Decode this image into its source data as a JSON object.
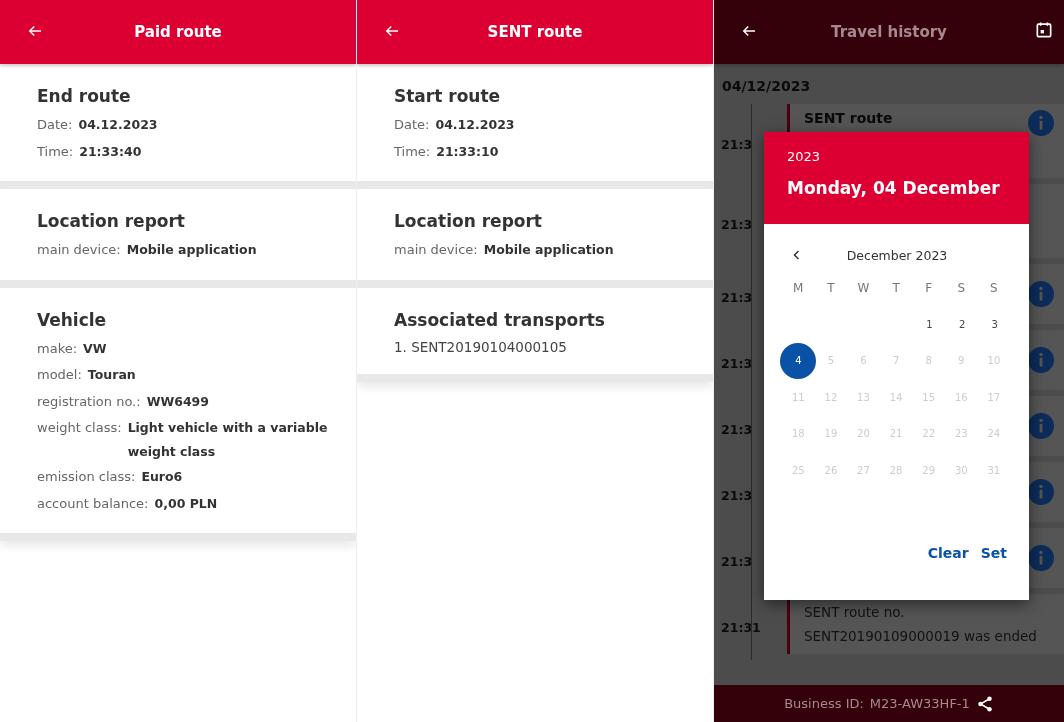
{
  "screens": [
    {
      "kind": "detail",
      "title": "Paid route",
      "sections": [
        {
          "title": "End route",
          "fields": [
            {
              "label": "Date:",
              "value": "04.12.2023"
            },
            {
              "label": "Time:",
              "value": "21:33:40"
            }
          ]
        },
        {
          "title": "Location report",
          "fields": [
            {
              "label": "main device:",
              "value": "Mobile application"
            }
          ]
        },
        {
          "title": "Vehicle",
          "fields": [
            {
              "label": "make:",
              "value": "VW"
            },
            {
              "label": "model:",
              "value": "Touran"
            },
            {
              "label": "registration no.:",
              "value": "WW6499"
            },
            {
              "label": "weight class:",
              "value": "Light vehicle with a variable weight class"
            },
            {
              "label": "emission class:",
              "value": "Euro6"
            },
            {
              "label": "account balance:",
              "value": "0,00 PLN"
            }
          ]
        }
      ]
    },
    {
      "kind": "detail",
      "title": "SENT route",
      "sections": [
        {
          "title": "Start route",
          "fields": [
            {
              "label": "Date:",
              "value": "04.12.2023"
            },
            {
              "label": "Time:",
              "value": "21:33:10"
            }
          ]
        },
        {
          "title": "Location report",
          "fields": [
            {
              "label": "main device:",
              "value": "Mobile application"
            }
          ]
        },
        {
          "title": "Associated transports",
          "items": [
            "1. SENT20190104000105"
          ]
        }
      ]
    },
    {
      "kind": "history",
      "title": "Travel history",
      "date": "04/12/2023",
      "entries": [
        {
          "time": "21:3",
          "title": "SENT route",
          "info": true
        },
        {
          "time": "21:3",
          "info": false
        },
        {
          "time": "21:3",
          "info": true
        },
        {
          "time": "21:3",
          "info": true
        },
        {
          "time": "21:3",
          "info": true
        },
        {
          "time": "21:3",
          "info": true
        },
        {
          "time": "21:3",
          "info": true
        },
        {
          "time": "21:31",
          "text": "SENT route no. SENT20190109000019 was ended",
          "info": false
        }
      ],
      "footer": {
        "label": "Business ID:",
        "value": "M23-AW33HF-1"
      },
      "date_picker": {
        "year": "2023",
        "date": "Monday, 04 December",
        "month": "December 2023",
        "weekdays": [
          "M",
          "T",
          "W",
          "T",
          "F",
          "S",
          "S"
        ],
        "weeks": [
          [
            {
              "label": "1",
              "selected": false,
              "disabled": false
            },
            {
              "label": "2",
              "selected": false,
              "disabled": false
            },
            {
              "label": "3",
              "selected": false,
              "disabled": false
            }
          ],
          [
            {
              "label": "4",
              "selected": true,
              "disabled": false
            },
            {
              "label": "5",
              "selected": false,
              "disabled": true
            },
            {
              "label": "6",
              "selected": false,
              "disabled": true
            },
            {
              "label": "7",
              "selected": false,
              "disabled": true
            },
            {
              "label": "8",
              "selected": false,
              "disabled": true
            },
            {
              "label": "9",
              "selected": false,
              "disabled": true
            },
            {
              "label": "10",
              "selected": false,
              "disabled": true
            }
          ],
          [
            {
              "label": "11",
              "selected": false,
              "disabled": true
            },
            {
              "label": "12",
              "selected": false,
              "disabled": true
            },
            {
              "label": "13",
              "selected": false,
              "disabled": true
            },
            {
              "label": "14",
              "selected": false,
              "disabled": true
            },
            {
              "label": "15",
              "selected": false,
              "disabled": true
            },
            {
              "label": "16",
              "selected": false,
              "disabled": true
            },
            {
              "label": "17",
              "selected": false,
              "disabled": true
            }
          ],
          [
            {
              "label": "18",
              "selected": false,
              "disabled": true
            },
            {
              "label": "19",
              "selected": false,
              "disabled": true
            },
            {
              "label": "20",
              "selected": false,
              "disabled": true
            },
            {
              "label": "21",
              "selected": false,
              "disabled": true
            },
            {
              "label": "22",
              "selected": false,
              "disabled": true
            },
            {
              "label": "23",
              "selected": false,
              "disabled": true
            },
            {
              "label": "24",
              "selected": false,
              "disabled": true
            }
          ],
          [
            {
              "label": "25",
              "selected": false,
              "disabled": true
            },
            {
              "label": "26",
              "selected": false,
              "disabled": true
            },
            {
              "label": "27",
              "selected": false,
              "disabled": true
            },
            {
              "label": "28",
              "selected": false,
              "disabled": true
            },
            {
              "label": "29",
              "selected": false,
              "disabled": true
            },
            {
              "label": "30",
              "selected": false,
              "disabled": true
            },
            {
              "label": "31",
              "selected": false,
              "disabled": true
            }
          ]
        ],
        "actions": [
          "Clear",
          "Set"
        ]
      }
    }
  ]
}
